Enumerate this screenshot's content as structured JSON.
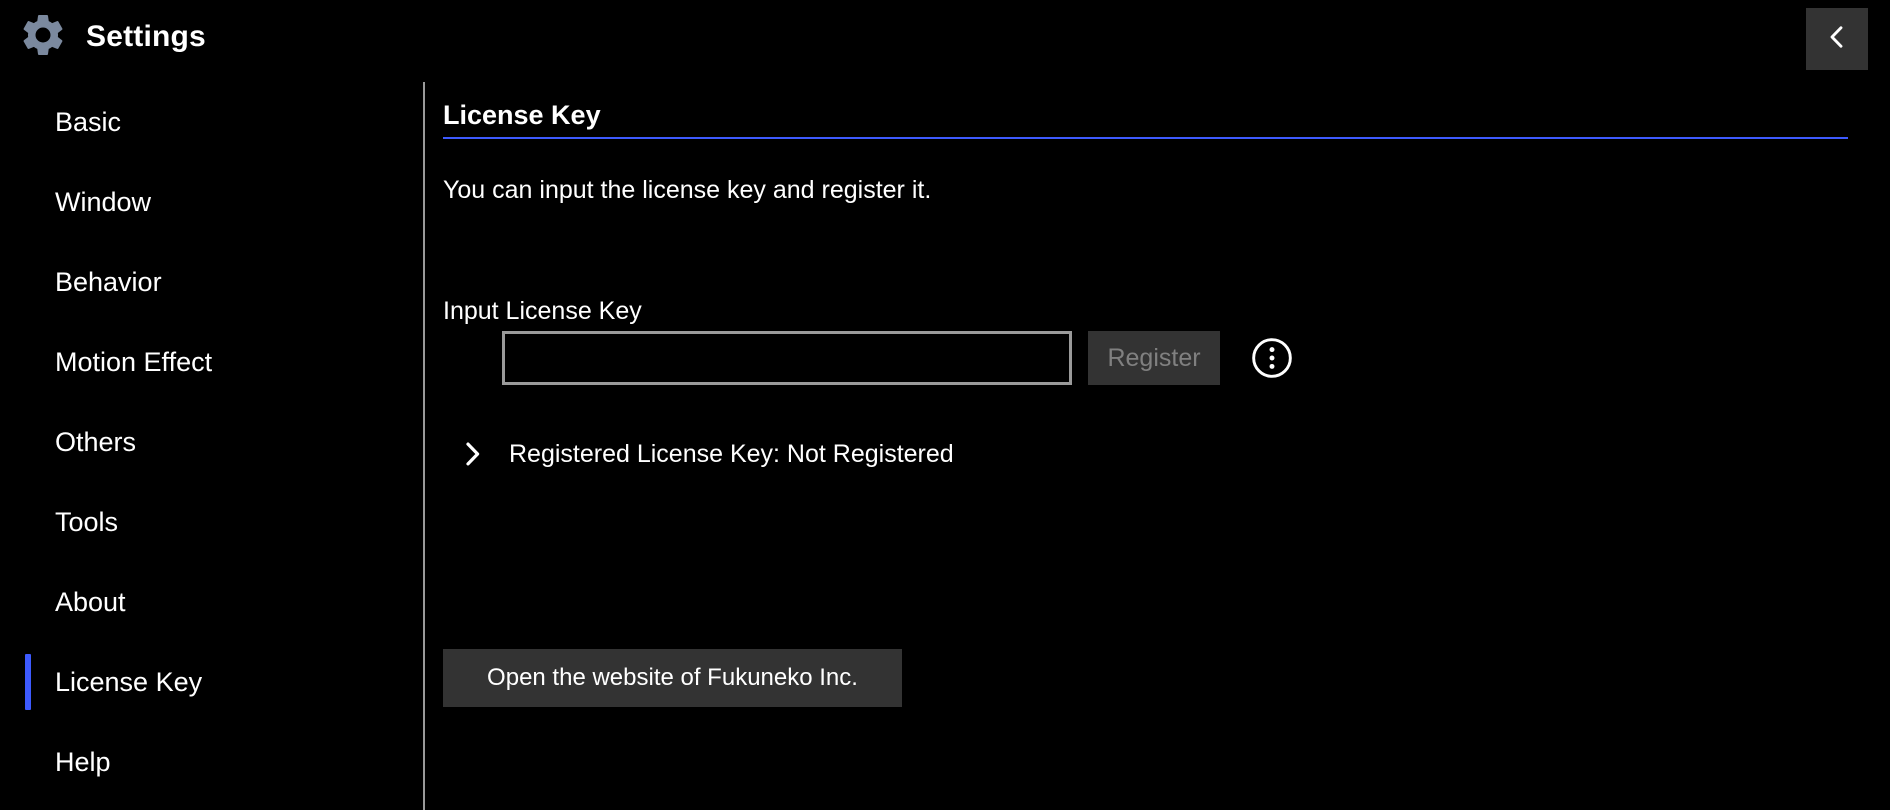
{
  "window": {
    "background_color": "#000000",
    "accent_color": "#3d5afe"
  },
  "titlebar": {
    "app_title": "Settings",
    "gear_icon": "gear-icon",
    "gear_icon_color": "#7b899e",
    "back_button": {
      "icon": "chevron-left-icon",
      "label": "",
      "background_color": "#333333"
    }
  },
  "sidebar": {
    "selected_index": 8,
    "items": [
      {
        "label": "Basic"
      },
      {
        "label": "Window"
      },
      {
        "label": "Behavior"
      },
      {
        "label": "Motion Effect"
      },
      {
        "label": "Others"
      },
      {
        "label": "Tools"
      },
      {
        "label": "About"
      },
      {
        "label": "License Key"
      },
      {
        "label": "Help"
      }
    ]
  },
  "content": {
    "page_title": "License Key",
    "description": "You can input the license key and register it.",
    "input_label": "Input License Key",
    "license_input": {
      "value": "",
      "placeholder": ""
    },
    "register_button": {
      "label": "Register",
      "enabled": false,
      "text_color": "#808080",
      "background_color": "#333333"
    },
    "info_icon": "circled-vertical-ellipsis-icon",
    "expander": {
      "icon": "chevron-right-icon",
      "expanded": false,
      "label": "Registered License Key: Not Registered"
    },
    "website_button": {
      "label": "Open the website of Fukuneko Inc."
    }
  }
}
